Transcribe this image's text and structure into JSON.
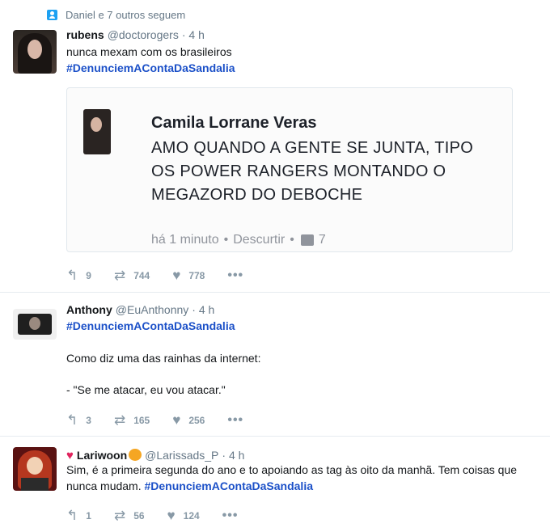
{
  "tweet1": {
    "context": "Daniel e 7 outros seguem",
    "name": "rubens",
    "handle": "@doctorogers",
    "time": "· 4 h",
    "text": "nunca mexam com os brasileiros",
    "hashtag": "#DenunciemAContaDaSandalia",
    "card": {
      "name": "Camila Lorrane Veras",
      "body": "AMO QUANDO A GENTE SE JUNTA, TIPO OS POWER RANGERS MONTANDO O MEGAZORD DO DEBOCHE",
      "time": "há 1 minuto",
      "dislike": "Descurtir",
      "sep": "•",
      "likes": "7"
    },
    "replies": "9",
    "retweets": "744",
    "likes": "778"
  },
  "tweet2": {
    "name": "Anthony",
    "handle": "@EuAnthonny",
    "time": "· 4 h",
    "hashtag": "#DenunciemAContaDaSandalia",
    "line1": "Como diz uma das rainhas da internet:",
    "line2": "- \"Se me atacar, eu vou atacar.\"",
    "replies": "3",
    "retweets": "165",
    "likes": "256"
  },
  "tweet3": {
    "name": "Lariwoon",
    "handle": "@Larissads_P",
    "time": "· 4 h",
    "text": "Sim, é a primeira segunda do ano e to apoiando as tag às oito da manhã. Tem coisas que nunca mudam.",
    "hashtag": "#DenunciemAContaDaSandalia",
    "replies": "1",
    "retweets": "56",
    "likes": "124"
  },
  "icons": {
    "reply": "reply-icon",
    "retweet": "retweet-icon",
    "like": "heart-icon",
    "more": "more-icon"
  }
}
